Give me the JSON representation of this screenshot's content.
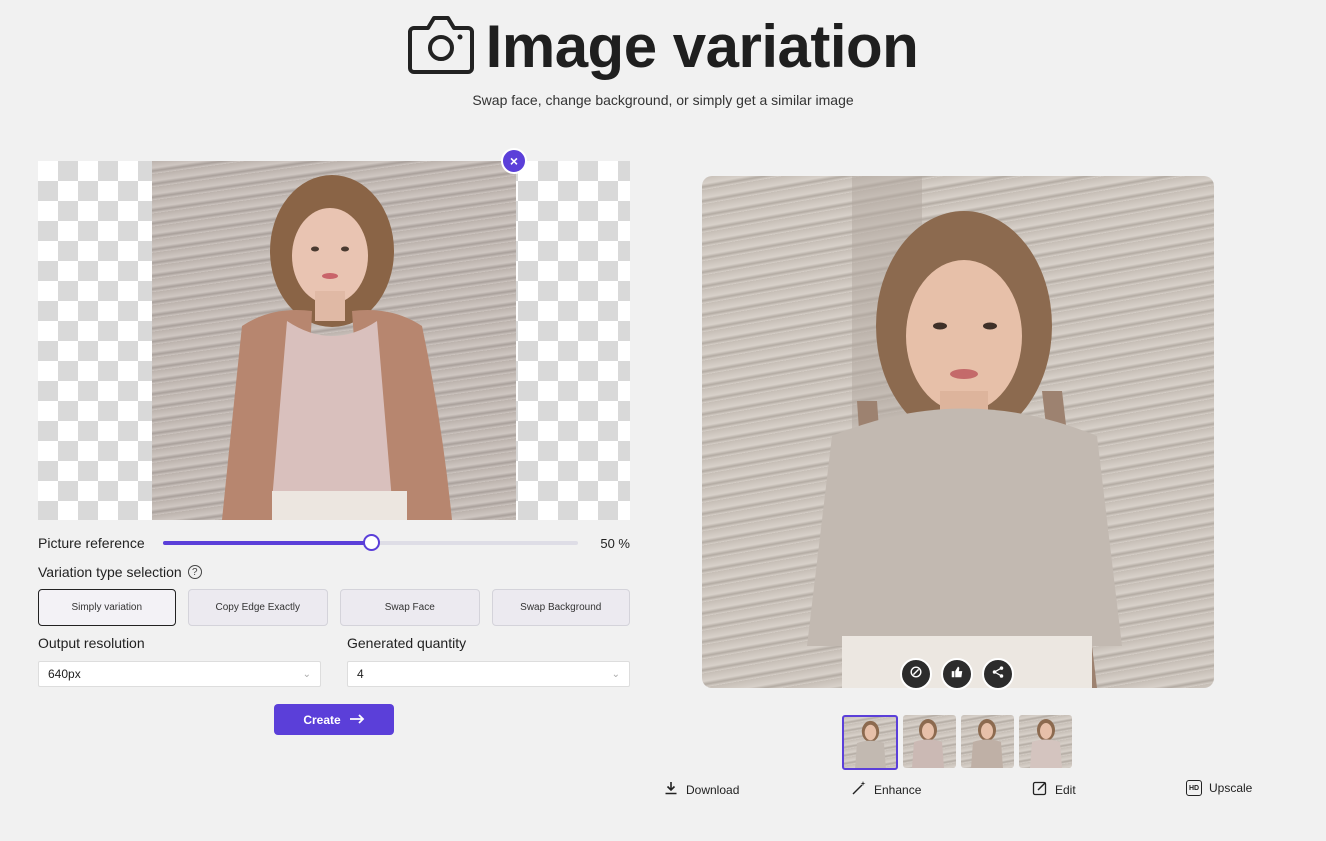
{
  "header": {
    "title": "Image variation",
    "subtitle": "Swap face, change background, or simply get a similar image",
    "icon": "camera-icon"
  },
  "upload": {
    "close_label": "×"
  },
  "slider": {
    "label": "Picture reference",
    "value_text": "50 %",
    "value_percent": 50
  },
  "variation": {
    "label": "Variation type selection",
    "help": "?",
    "options": [
      {
        "label": "Simply variation",
        "active": true
      },
      {
        "label": "Copy Edge Exactly",
        "active": false
      },
      {
        "label": "Swap Face",
        "active": false
      },
      {
        "label": "Swap Background",
        "active": false
      }
    ]
  },
  "output": {
    "resolution_label": "Output resolution",
    "resolution_value": "640px",
    "quantity_label": "Generated quantity",
    "quantity_value": "4"
  },
  "create": {
    "label": "Create"
  },
  "tools": {
    "download": "Download",
    "enhance": "Enhance",
    "edit": "Edit",
    "upscale": "Upscale",
    "upscale_badge": "HD"
  },
  "colors": {
    "accent": "#5b3fd9",
    "background": "#f1f1f1"
  }
}
